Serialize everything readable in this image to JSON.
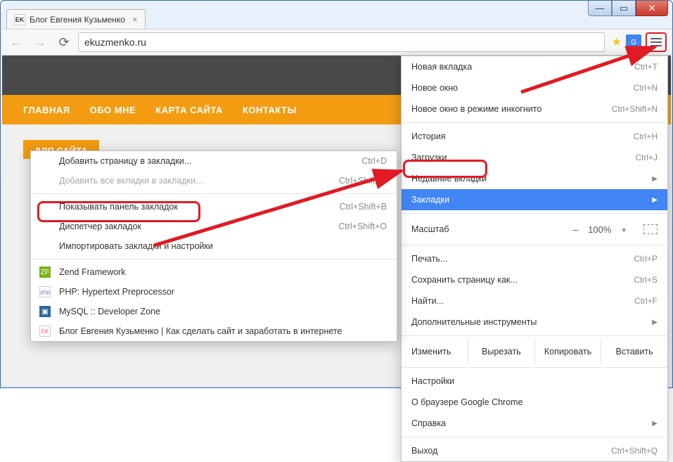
{
  "window": {
    "tab_title": "Блог Евгения Кузьменко",
    "favicon_text": "EK"
  },
  "toolbar": {
    "url": "ekuzmenko.ru"
  },
  "page": {
    "nav": [
      "ГЛАВНАЯ",
      "ОБО МНЕ",
      "КАРТА САЙТА",
      "КОНТАКТЫ"
    ],
    "widget_title": "ДЛЯ САЙТА"
  },
  "main_menu": {
    "items": [
      {
        "label": "Новая вкладка",
        "shortcut": "Ctrl+T"
      },
      {
        "label": "Новое окно",
        "shortcut": "Ctrl+N"
      },
      {
        "label": "Новое окно в режиме инкогнито",
        "shortcut": "Ctrl+Shift+N"
      }
    ],
    "group2": [
      {
        "label": "История",
        "shortcut": "Ctrl+H"
      },
      {
        "label": "Загрузки",
        "shortcut": "Ctrl+J"
      },
      {
        "label": "Недавние вкладки",
        "arrow": true
      },
      {
        "label": "Закладки",
        "arrow": true,
        "selected": true
      }
    ],
    "zoom": {
      "label": "Масштаб",
      "minus": "–",
      "value": "100%",
      "plus": "+"
    },
    "group3": [
      {
        "label": "Печать...",
        "shortcut": "Ctrl+P"
      },
      {
        "label": "Сохранить страницу как...",
        "shortcut": "Ctrl+S"
      },
      {
        "label": "Найти...",
        "shortcut": "Ctrl+F"
      },
      {
        "label": "Дополнительные инструменты",
        "arrow": true
      }
    ],
    "edit": {
      "label": "Изменить",
      "cut": "Вырезать",
      "copy": "Копировать",
      "paste": "Вставить"
    },
    "group4": [
      {
        "label": "Настройки"
      },
      {
        "label": "О браузере Google Chrome"
      },
      {
        "label": "Справка",
        "arrow": true
      }
    ],
    "exit": {
      "label": "Выход",
      "shortcut": "Ctrl+Shift+Q"
    }
  },
  "submenu": {
    "items_top": [
      {
        "label": "Добавить страницу в закладки...",
        "shortcut": "Ctrl+D"
      },
      {
        "label": "Добавить все вкладки в закладки...",
        "shortcut": "Ctrl+Shift+D",
        "disabled": true
      }
    ],
    "items_mid": [
      {
        "label": "Показывать панель закладок",
        "shortcut": "Ctrl+Shift+B"
      },
      {
        "label": "Диспетчер закладок",
        "shortcut": "Ctrl+Shift+O"
      },
      {
        "label": "Импортировать закладки и настройки"
      }
    ],
    "bookmarks": [
      {
        "icon": "ZF",
        "icon_bg": "#7cb518",
        "label": "Zend Framework"
      },
      {
        "icon": "php",
        "icon_bg": "#6181b6",
        "label": "PHP: Hypertext Preprocessor"
      },
      {
        "icon": "▣",
        "icon_bg": "#2c6aa0",
        "label": "MySQL :: Developer Zone"
      },
      {
        "icon": "EK",
        "icon_bg": "#ffffff",
        "label": "Блог Евгения Кузьменко | Как сделать сайт и заработать в интернете"
      }
    ]
  }
}
